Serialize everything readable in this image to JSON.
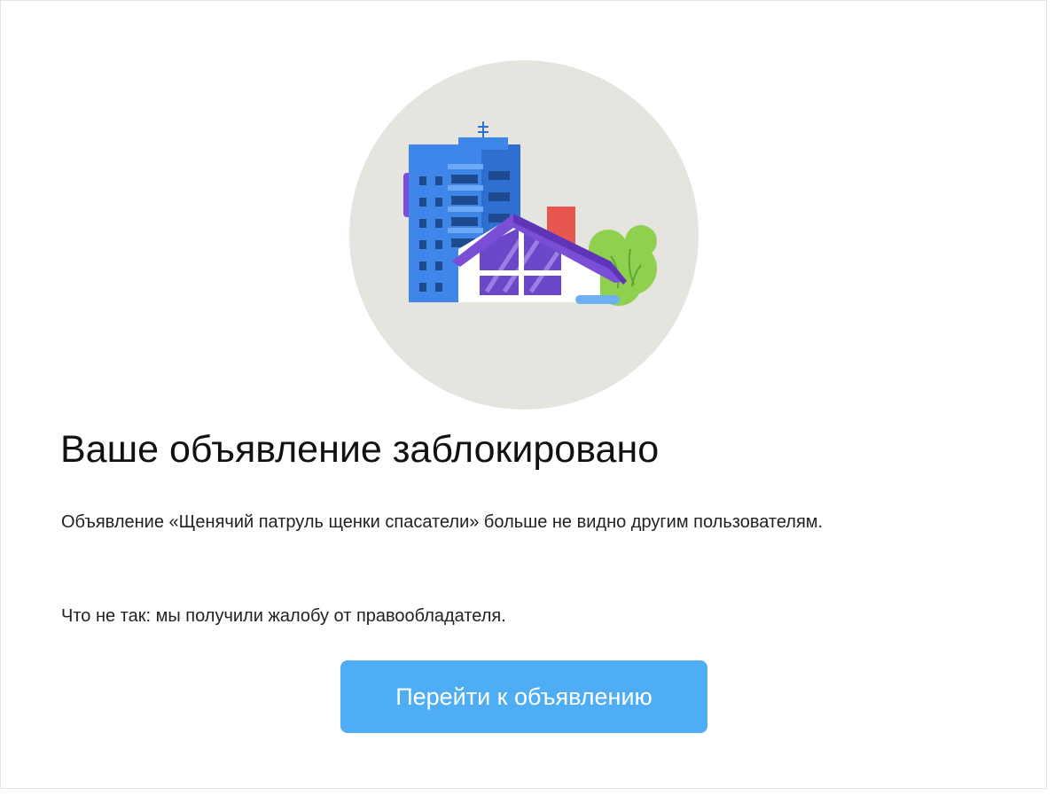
{
  "notice": {
    "title": "Ваше объявление заблокировано",
    "message": "Объявление «Щенячий патруль щенки спасатели» больше не видно другим пользователям.",
    "reason": "Что не так: мы получили жалобу от правообладателя.",
    "button_label": "Перейти к объявлению"
  },
  "illustration": {
    "subject": "apartment-building-and-house",
    "colors": {
      "circle_bg": "#e6e4df",
      "building": "#3f86ea",
      "house_roof": "#7a4fd6",
      "house_wall": "#ffffff",
      "chimney": "#e8574f",
      "tree": "#8fd14f"
    }
  },
  "colors": {
    "accent": "#4eadf5",
    "text": "#111111"
  }
}
